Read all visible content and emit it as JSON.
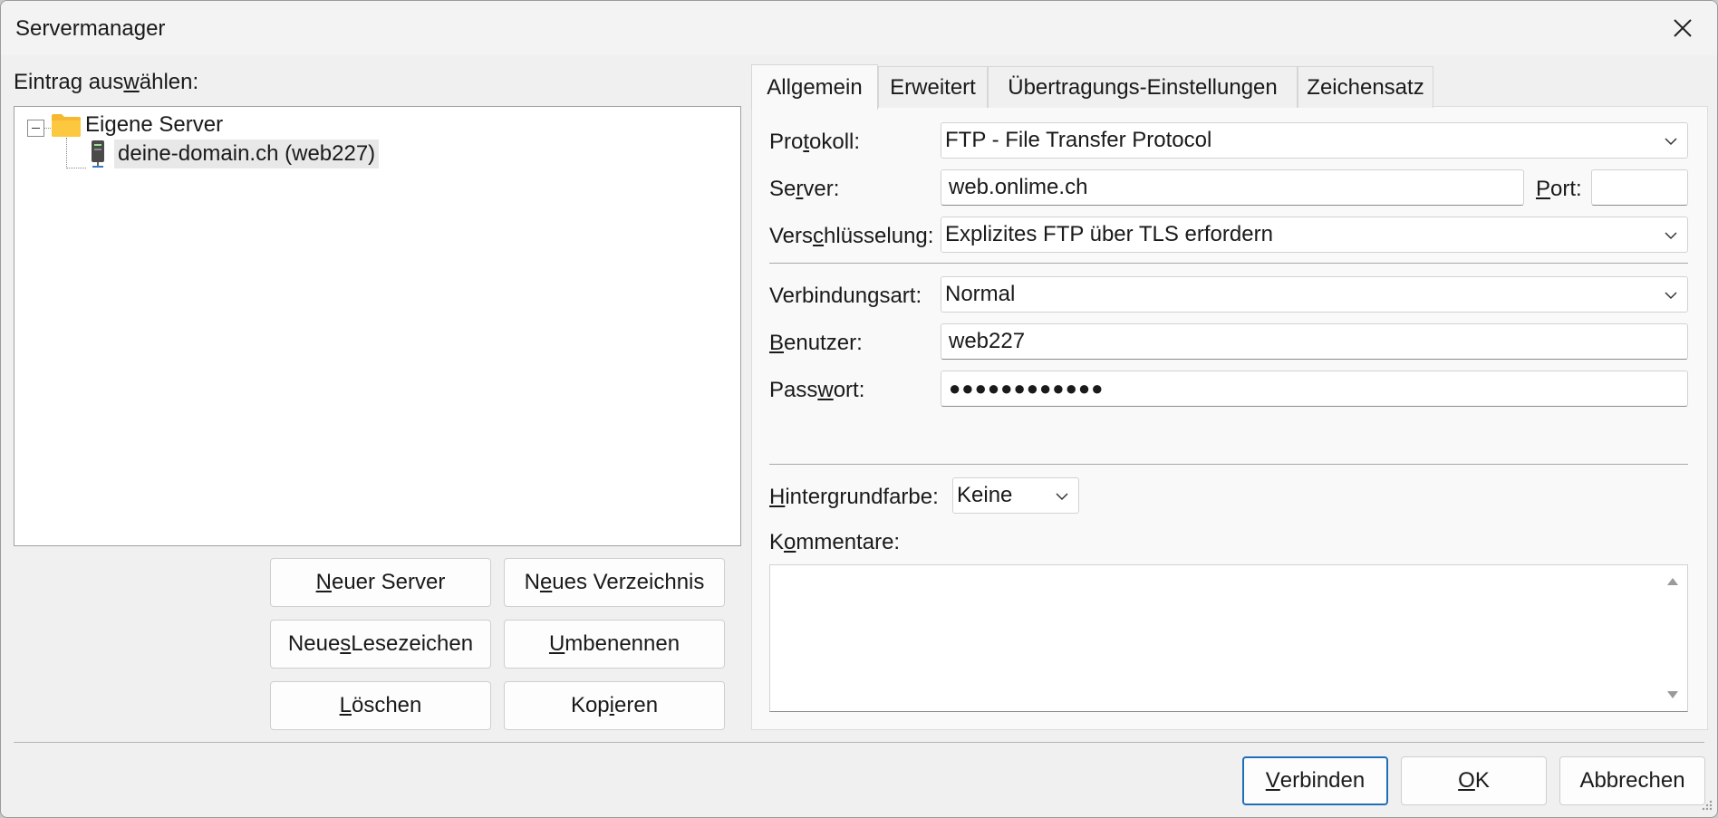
{
  "window": {
    "title": "Servermanager"
  },
  "left": {
    "select_label_pre": "Eintrag aus",
    "select_label_u": "w",
    "select_label_post": "ählen:",
    "tree": {
      "root": "Eigene Server",
      "child": "deine-domain.ch (web227)"
    },
    "buttons": {
      "new_server": {
        "pre": "",
        "u": "N",
        "post": "euer Server"
      },
      "new_folder": {
        "pre": "N",
        "u": "e",
        "post": "ues Verzeichnis"
      },
      "new_bookmark": {
        "pre": "Neue",
        "u": "s",
        "post": " Lesezeichen"
      },
      "rename": {
        "pre": "",
        "u": "U",
        "post": "mbenennen"
      },
      "delete": {
        "pre": "",
        "u": "L",
        "post": "öschen"
      },
      "copy": {
        "pre": "Kop",
        "u": "i",
        "post": "eren"
      }
    }
  },
  "tabs": [
    "Allgemein",
    "Erweitert",
    "Übertragungs-Einstellungen",
    "Zeichensatz"
  ],
  "general": {
    "protocol": {
      "label_pre": "Pro",
      "label_u": "t",
      "label_post": "okoll:",
      "value": "FTP - File Transfer Protocol"
    },
    "server": {
      "label_pre": "Se",
      "label_u": "r",
      "label_post": "ver:",
      "value": "web.onlime.ch"
    },
    "port": {
      "label_pre": "",
      "label_u": "P",
      "label_post": "ort:",
      "value": ""
    },
    "encryption": {
      "label_pre": "Vers",
      "label_u": "c",
      "label_post": "hlüsselung:",
      "value": "Explizites FTP über TLS erfordern"
    },
    "logon_type": {
      "label": "Verbindungsart:",
      "value": "Normal"
    },
    "user": {
      "label_pre": "",
      "label_u": "B",
      "label_post": "enutzer:",
      "value": "web227"
    },
    "password": {
      "label_pre": "Pass",
      "label_u": "w",
      "label_post": "ort:",
      "value": "●●●●●●●●●●●●"
    },
    "background": {
      "label_pre": "",
      "label_u": "H",
      "label_post": "intergrundfarbe:",
      "value": "Keine"
    },
    "comments": {
      "label_pre": "K",
      "label_u": "o",
      "label_post": "mmentare:",
      "value": ""
    }
  },
  "footer": {
    "connect": {
      "pre": "",
      "u": "V",
      "post": "erbinden"
    },
    "ok": {
      "pre": "",
      "u": "O",
      "post": "K"
    },
    "cancel": "Abbrechen"
  },
  "icons": {
    "close": "close-icon",
    "folder": "folder-icon",
    "server": "server-icon",
    "chevron": "chevron-down-icon"
  },
  "colors": {
    "folder": "#f5b82e",
    "primary_border": "#1f6fb8"
  }
}
